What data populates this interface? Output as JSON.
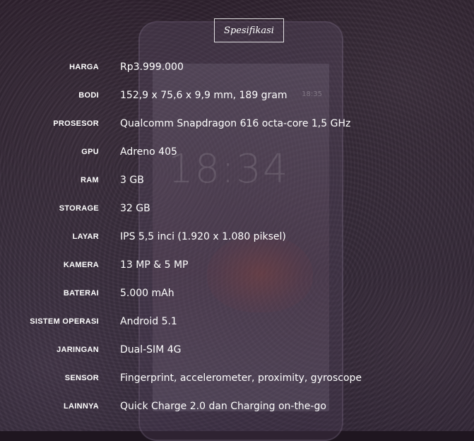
{
  "title": "Spesifikasi",
  "phone_backdrop": {
    "time": "18:34",
    "status": "18:35"
  },
  "specs": [
    {
      "label": "HARGA",
      "value": "Rp3.999.000"
    },
    {
      "label": "BODI",
      "value": "152,9 x 75,6 x 9,9 mm, 189 gram"
    },
    {
      "label": "PROSESOR",
      "value": "Qualcomm Snapdragon 616 octa-core 1,5 GHz"
    },
    {
      "label": "GPU",
      "value": "Adreno 405"
    },
    {
      "label": "RAM",
      "value": "3 GB"
    },
    {
      "label": "STORAGE",
      "value": "32 GB"
    },
    {
      "label": "LAYAR",
      "value": "IPS 5,5 inci (1.920 x 1.080 piksel)"
    },
    {
      "label": "KAMERA",
      "value": "13 MP & 5 MP"
    },
    {
      "label": "BATERAI",
      "value": "5.000 mAh"
    },
    {
      "label": "SISTEM OPERASI",
      "value": "Android 5.1"
    },
    {
      "label": "JARINGAN",
      "value": "Dual-SIM 4G"
    },
    {
      "label": "SENSOR",
      "value": "Fingerprint, accelerometer, proximity, gyroscope"
    },
    {
      "label": "LAINNYA",
      "value": "Quick Charge 2.0 dan Charging on-the-go"
    }
  ]
}
